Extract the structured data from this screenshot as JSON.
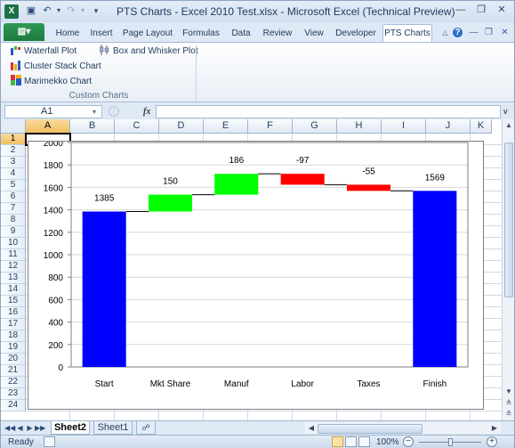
{
  "window": {
    "title": "PTS Charts - Excel 2010 Test.xlsx  -  Microsoft Excel (Technical Preview)",
    "app_icon": "excel-icon"
  },
  "ribbon_tabs": {
    "file": "File",
    "tabs": [
      "Home",
      "Insert",
      "Page Layout",
      "Formulas",
      "Data",
      "Review",
      "View",
      "Developer",
      "PTS Charts"
    ],
    "active": "PTS Charts"
  },
  "ribbon": {
    "group_label": "Custom Charts",
    "buttons": {
      "waterfall": "Waterfall Plot",
      "cluster": "Cluster Stack Chart",
      "marimekko": "Marimekko Chart",
      "boxwhisker": "Box and Whisker Plot"
    }
  },
  "formula_bar": {
    "namebox": "A1",
    "fx": "fx",
    "value": ""
  },
  "grid": {
    "columns": [
      "A",
      "B",
      "C",
      "D",
      "E",
      "F",
      "G",
      "H",
      "I",
      "J",
      "K"
    ],
    "rows": [
      "1",
      "2",
      "3",
      "4",
      "5",
      "6",
      "7",
      "8",
      "9",
      "10",
      "11",
      "12",
      "13",
      "14",
      "15",
      "16",
      "17",
      "18",
      "19",
      "20",
      "21",
      "22",
      "23",
      "24"
    ],
    "selected_cell": "A1"
  },
  "chart_data": {
    "type": "bar",
    "subtype": "waterfall",
    "categories": [
      "Start",
      "Mkt Share",
      "Manuf",
      "Labor",
      "Taxes",
      "Finish"
    ],
    "values": [
      1385,
      150,
      186,
      -97,
      -55,
      1569
    ],
    "labels": [
      "1385",
      "150",
      "186",
      "-97",
      "-55",
      "1569"
    ],
    "kinds": [
      "total",
      "delta",
      "delta",
      "delta",
      "delta",
      "total"
    ],
    "ylim": [
      0,
      2000
    ],
    "yticks": [
      "0",
      "200",
      "400",
      "600",
      "800",
      "1000",
      "1200",
      "1400",
      "1600",
      "1800",
      "2000"
    ],
    "colors": {
      "total": "#0000ff",
      "increase": "#00ff00",
      "decrease": "#ff0000"
    },
    "grid": true,
    "legend": "none"
  },
  "sheets": {
    "tabs": [
      "Sheet2",
      "Sheet1"
    ],
    "active": "Sheet2"
  },
  "status": {
    "ready": "Ready",
    "zoom": "100%"
  }
}
